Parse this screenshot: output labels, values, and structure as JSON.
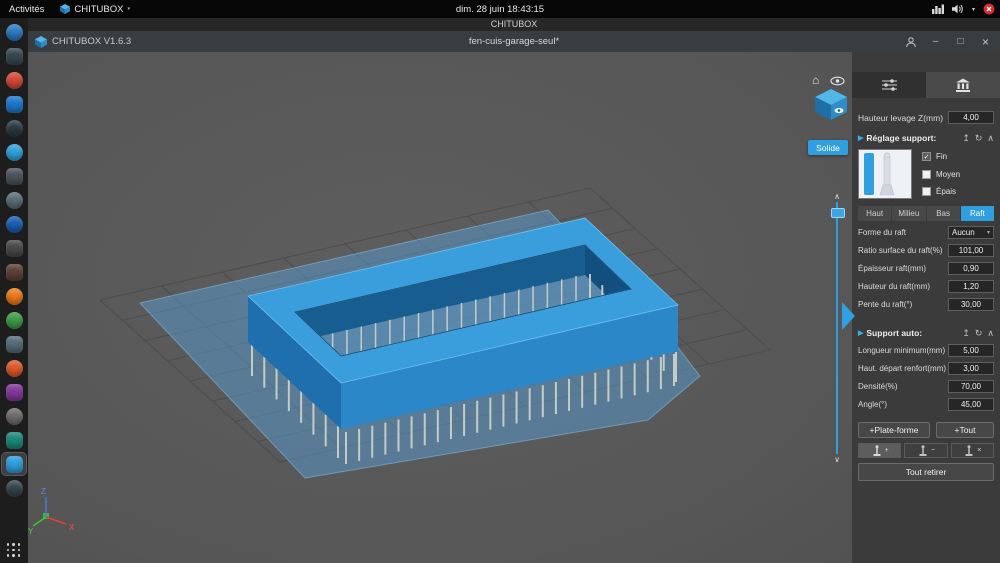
{
  "topbar": {
    "activities": "Activités",
    "app_menu": "CHITUBOX",
    "clock": "dim. 28 juin 18:43:15"
  },
  "apptitle": "CHITUBOX",
  "windowbar": {
    "version": "CHITUBOX V1.6.3",
    "document": "fen-cuis-garage-seul*"
  },
  "viewport": {
    "solid_label": "Solide"
  },
  "panel": {
    "lift_label": "Hauteur levage Z(mm)",
    "lift_value": "4,00",
    "support_header": "Réglage support:",
    "thickness": [
      {
        "label": "Fin",
        "checked": true
      },
      {
        "label": "Moyen",
        "checked": false
      },
      {
        "label": "Épais",
        "checked": false
      }
    ],
    "tabs": [
      {
        "label": "Haut",
        "active": false
      },
      {
        "label": "Milieu",
        "active": false
      },
      {
        "label": "Bas",
        "active": false
      },
      {
        "label": "Raft",
        "active": true
      }
    ],
    "raft_fields": [
      {
        "label": "Forme du raft",
        "value": "Aucun"
      },
      {
        "label": "Ratio surface du raft(%)",
        "value": "101,00"
      },
      {
        "label": "Épaisseur raft(mm)",
        "value": "0,90"
      },
      {
        "label": "Hauteur du raft(mm)",
        "value": "1,20"
      },
      {
        "label": "Pente du raft(°)",
        "value": "30,00"
      }
    ],
    "auto_header": "Support auto:",
    "auto_fields": [
      {
        "label": "Longueur minimum(mm)",
        "value": "5,00"
      },
      {
        "label": "Haut. départ renfort(mm)",
        "value": "3,00"
      },
      {
        "label": "Densité(%)",
        "value": "70,00"
      },
      {
        "label": "Angle(°)",
        "value": "45,00"
      }
    ],
    "platform_button": "+Plate-forme",
    "all_button": "+Tout",
    "remove_all_button": "Tout retirer"
  },
  "icons": {
    "home": "⌂",
    "chevron_up": "∧",
    "chevron_down": "∨",
    "caret_down": "▾",
    "menu_caret": "▼",
    "section_arrow": "▶",
    "export": "↥",
    "reset": "↻",
    "collapse": "∧",
    "check": "✓",
    "minimize": "–",
    "maximize": "□",
    "close": "×",
    "plus": "+",
    "minus": "−",
    "cross": "×"
  },
  "colors": {
    "accent": "#2f9fe0"
  },
  "dock": {
    "items": [
      {
        "color": "#2d7bc4",
        "round": true
      },
      {
        "color": "#37474f",
        "round": false
      },
      {
        "color": "#d84a38",
        "round": true
      },
      {
        "color": "#1e78d0",
        "round": false
      },
      {
        "color": "#2b3a42",
        "round": true
      },
      {
        "color": "#30a3dc",
        "round": true
      },
      {
        "color": "#4a545b",
        "round": false
      },
      {
        "color": "#5d6e78",
        "round": true
      },
      {
        "color": "#1a5fb4",
        "round": true
      },
      {
        "color": "#494949",
        "round": false
      },
      {
        "color": "#5d4037",
        "round": false
      },
      {
        "color": "#ef7b1a",
        "round": true
      },
      {
        "color": "#3f9d46",
        "round": true
      },
      {
        "color": "#566c78",
        "round": false
      },
      {
        "color": "#e05a2b",
        "round": true
      },
      {
        "color": "#84379e",
        "round": false
      },
      {
        "color": "#6f6f6f",
        "round": true
      },
      {
        "color": "#1b8a7a",
        "round": false
      },
      {
        "color": "#2f9fe0",
        "round": false,
        "active": true
      },
      {
        "color": "#35454d",
        "round": true
      }
    ]
  }
}
